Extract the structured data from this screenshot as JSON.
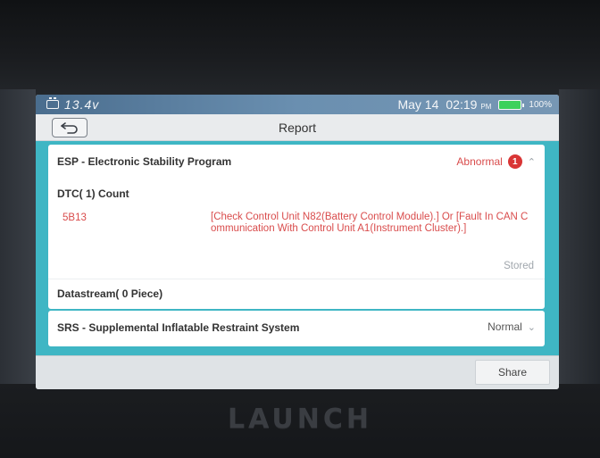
{
  "status_bar": {
    "voltage": "13.4v",
    "date": "May 14",
    "time": "02:19",
    "ampm": "PM",
    "battery_percent": "100%",
    "battery_level": 1.0,
    "battery_color": "#3cd15c"
  },
  "title_bar": {
    "title": "Report"
  },
  "systems": [
    {
      "name": "ESP - Electronic Stability Program",
      "status": "Abnormal",
      "badge_count": "1",
      "dtc_count_label": "DTC( 1) Count",
      "dtcs": [
        {
          "code": "5B13",
          "description": "[Check Control Unit N82(Battery Control Module).] Or [Fault In CAN Communication With Control Unit A1(Instrument Cluster).]",
          "state": "Stored"
        }
      ],
      "datastream_label": "Datastream( 0 Piece)"
    },
    {
      "name": "SRS - Supplemental Inflatable Restraint System",
      "status": "Normal"
    }
  ],
  "bottom_bar": {
    "share_label": "Share"
  },
  "device": {
    "brand": "LAUNCH"
  },
  "colors": {
    "accent": "#3fb6c4",
    "error": "#d94c4c",
    "badge": "#d93535"
  },
  "icons": {
    "back": "back-arrow-icon",
    "car_battery": "car-battery-icon",
    "battery": "battery-icon",
    "collapse": "chevron-up-icon",
    "expand": "chevron-down-icon"
  }
}
